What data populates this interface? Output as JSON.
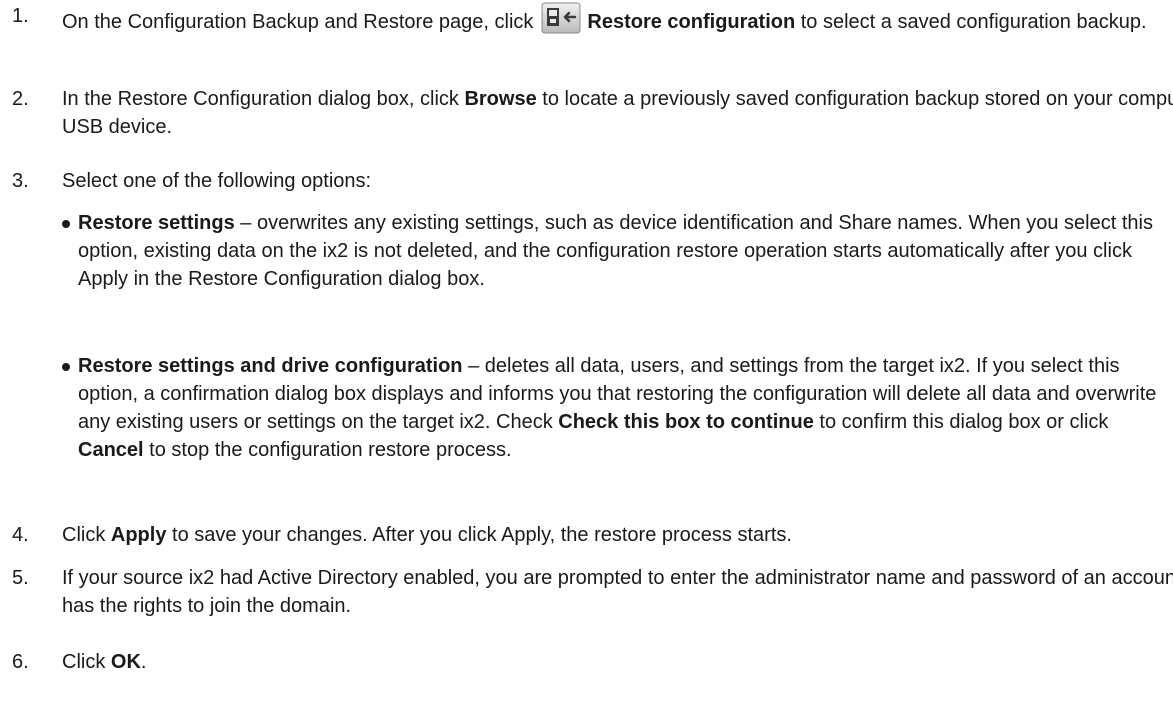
{
  "steps": [
    {
      "num": "1.",
      "pre": "On the Configuration Backup and Restore page, click",
      "icon": "restore-configuration-icon",
      "bold": "Restore configuration",
      "post": " to select a saved configuration backup."
    },
    {
      "num": "2.",
      "pre": "In the Restore Configuration dialog box, click ",
      "bold": "Browse",
      "post": " to locate a previously saved configuration backup stored on your computer or USB device."
    },
    {
      "num": "3.",
      "text": "Select one of the following options:",
      "options": [
        {
          "bold": "Restore settings",
          "text": " – overwrites any existing settings, such as device identification and Share names. When you select this option, existing data on the ix2 is not deleted, and the configuration restore operation starts automatically after you click Apply in the Restore Configuration dialog box."
        },
        {
          "bold": "Restore settings and drive configuration",
          "text1": " – deletes all data, users, and settings from the target ix2. If you select this option, a confirmation dialog box displays and informs you that restoring the configuration will delete all data and overwrite any existing users or settings on the target ix2. Check ",
          "bold2": "Check this box to continue",
          "text2": " to confirm this dialog box or click ",
          "bold3": "Cancel",
          "text3": " to stop the configuration restore process."
        }
      ]
    },
    {
      "num": "4.",
      "pre": "Click ",
      "bold": "Apply",
      "post": " to save your changes. After you click Apply, the restore process starts."
    },
    {
      "num": "5.",
      "text": "If your source ix2 had Active Directory enabled, you are prompted to enter the administrator name and password of an account that has the rights to join the domain."
    },
    {
      "num": "6.",
      "pre": "Click ",
      "bold": "OK",
      "post": "."
    }
  ]
}
